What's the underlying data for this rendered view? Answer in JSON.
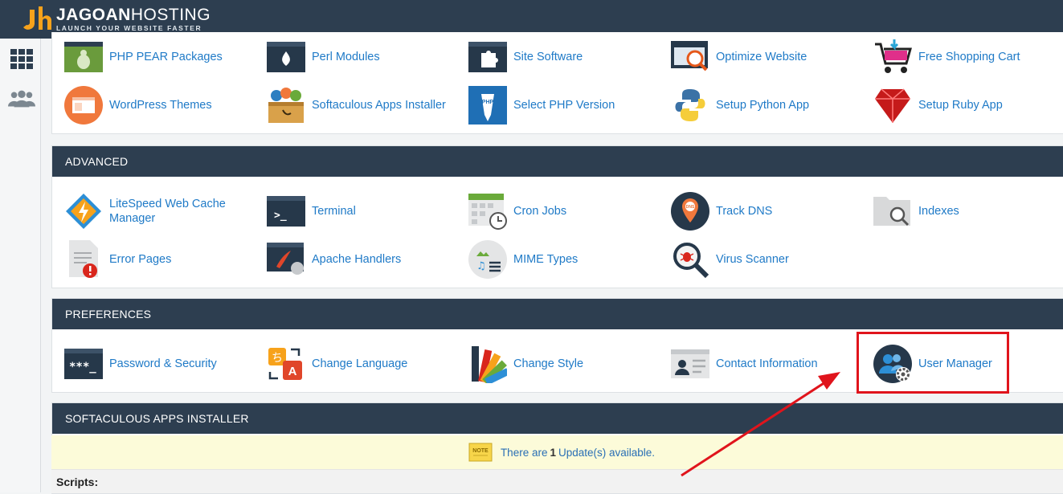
{
  "brand": {
    "name_bold": "JAGOAN",
    "name_thin": "HOSTING",
    "tagline": "LAUNCH YOUR WEBSITE FASTER",
    "colors": {
      "header": "#2d3e50",
      "link": "#1f7ac7",
      "highlight": "#e0141c",
      "logo_orange": "#f7a21b"
    }
  },
  "sidebar": {
    "items": [
      {
        "icon": "grid-icon"
      },
      {
        "icon": "users-icon"
      }
    ]
  },
  "software": {
    "items": [
      {
        "label": "PHP PEAR Packages",
        "icon": "php-pear-icon"
      },
      {
        "label": "Perl Modules",
        "icon": "perl-onion-icon"
      },
      {
        "label": "Site Software",
        "icon": "puzzle-icon"
      },
      {
        "label": "Optimize Website",
        "icon": "optimize-icon"
      },
      {
        "label": "Free Shopping Cart",
        "icon": "shopping-cart-icon"
      },
      {
        "label": "WordPress Themes",
        "icon": "wordpress-themes-icon"
      },
      {
        "label": "Softaculous Apps Installer",
        "icon": "softaculous-box-icon"
      },
      {
        "label": "Select PHP Version",
        "icon": "php-version-icon"
      },
      {
        "label": "Setup Python App",
        "icon": "python-icon"
      },
      {
        "label": "Setup Ruby App",
        "icon": "ruby-icon"
      }
    ]
  },
  "advanced": {
    "title": "ADVANCED",
    "items": [
      {
        "label": "LiteSpeed Web Cache Manager",
        "icon": "litespeed-icon"
      },
      {
        "label": "Terminal",
        "icon": "terminal-icon"
      },
      {
        "label": "Cron Jobs",
        "icon": "cron-calendar-icon"
      },
      {
        "label": "Track DNS",
        "icon": "dns-pin-icon"
      },
      {
        "label": "Indexes",
        "icon": "indexes-folder-icon"
      },
      {
        "label": "Error Pages",
        "icon": "error-page-icon"
      },
      {
        "label": "Apache Handlers",
        "icon": "apache-handlers-icon"
      },
      {
        "label": "MIME Types",
        "icon": "mime-types-icon"
      },
      {
        "label": "Virus Scanner",
        "icon": "virus-scanner-icon"
      }
    ]
  },
  "preferences": {
    "title": "PREFERENCES",
    "items": [
      {
        "label": "Password & Security",
        "icon": "password-icon"
      },
      {
        "label": "Change Language",
        "icon": "language-icon"
      },
      {
        "label": "Change Style",
        "icon": "style-swatch-icon"
      },
      {
        "label": "Contact Information",
        "icon": "contact-card-icon"
      },
      {
        "label": "User Manager",
        "icon": "user-manager-icon"
      }
    ]
  },
  "softaculous": {
    "title": "SOFTACULOUS APPS INSTALLER",
    "notice_prefix": "There are",
    "notice_count": "1",
    "notice_suffix": "Update(s) available.",
    "note_icon_label": "NOTE",
    "scripts_label": "Scripts:"
  }
}
